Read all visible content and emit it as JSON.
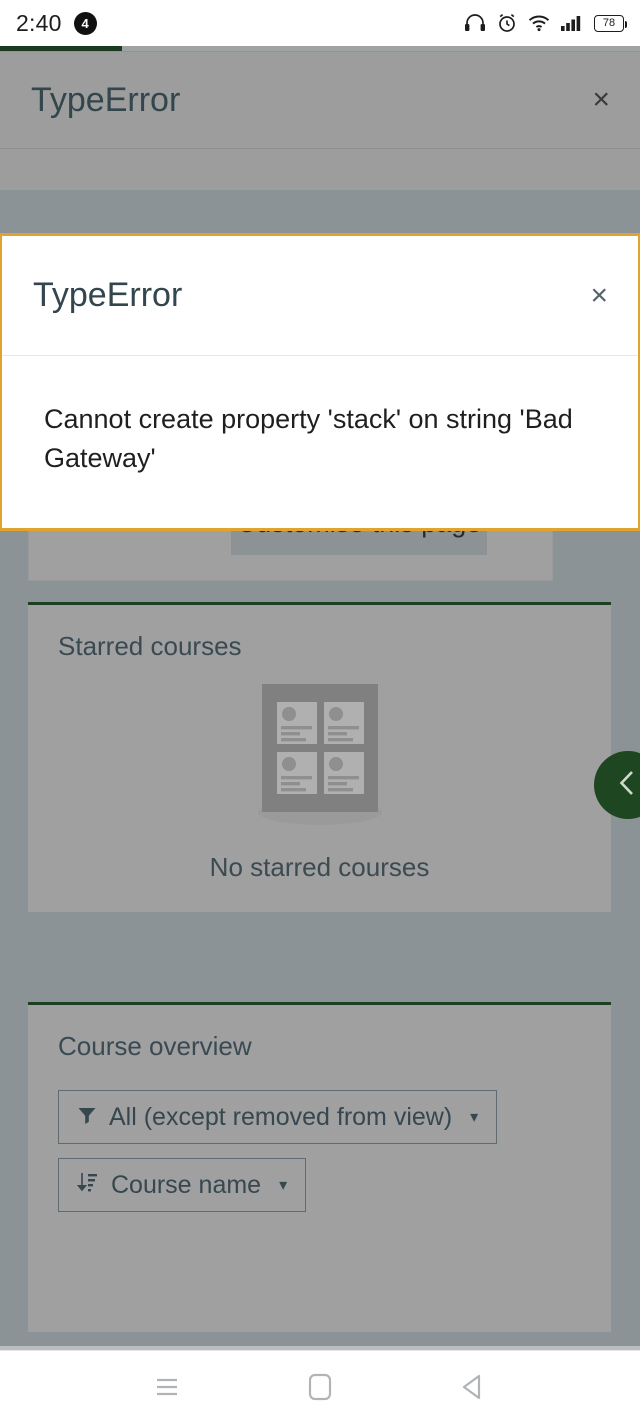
{
  "status_bar": {
    "time": "2:40",
    "notification_count": "4",
    "battery_level": "78",
    "icons": [
      "headset-icon",
      "alarm-icon",
      "wifi-icon",
      "signal-icon",
      "battery-icon"
    ]
  },
  "progress": {
    "percent": 19
  },
  "colors": {
    "accent_green": "#1e4620",
    "block_top_border": "#1e3f22",
    "dialog_border": "#e0a32e",
    "page_background": "#8b9396",
    "card_background": "#a0a0a0",
    "heading_text": "#3a4a52"
  },
  "background_dialog": {
    "title": "TypeError",
    "close_label": "×"
  },
  "modal_dialog": {
    "title": "TypeError",
    "close_label": "×",
    "message": "Cannot create property 'stack' on string 'Bad Gateway'"
  },
  "customise": {
    "button_label": "Customise this page"
  },
  "starred_courses": {
    "title": "Starred courses",
    "empty_text": "No starred courses",
    "illustration": "course-cards-placeholder-icon"
  },
  "course_overview": {
    "title": "Course overview",
    "filter": {
      "icon": "filter-funnel-icon",
      "label": "All (except removed from view)",
      "caret": "▾"
    },
    "sort": {
      "icon": "sort-ascending-icon",
      "label": "Course name",
      "caret": "▾"
    }
  },
  "drawer_tab": {
    "icon": "chevron-left-icon",
    "label": "Open block drawer"
  },
  "nav_bar": {
    "recents": "recents-icon",
    "home": "home-icon",
    "back": "back-icon"
  }
}
